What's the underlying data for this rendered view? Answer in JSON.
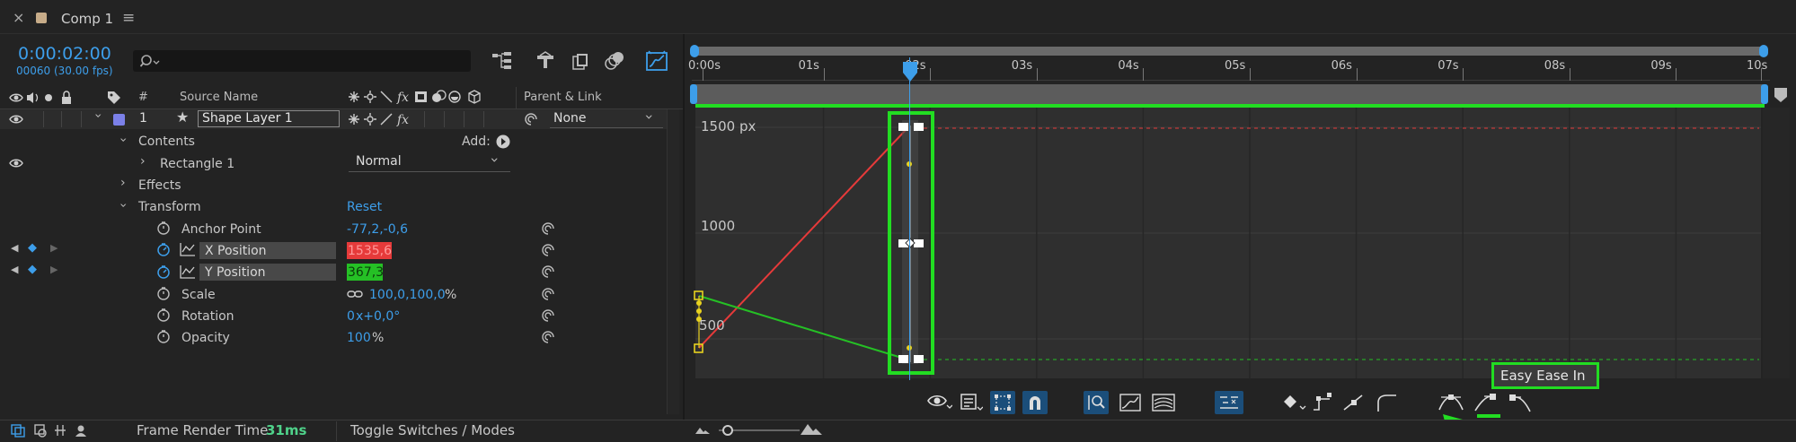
{
  "tab": {
    "close": "×",
    "title": "Comp 1",
    "menu": "≡"
  },
  "time": {
    "timecode": "0:00:02:00",
    "frames": "00060 (30.00 fps)"
  },
  "search": {
    "icon": "search-icon",
    "placeholder": ""
  },
  "columns": {
    "num": "#",
    "source_name": "Source Name",
    "parent_link": "Parent & Link"
  },
  "layer": {
    "index": "1",
    "name": "Shape Layer 1",
    "parent": "None"
  },
  "tree": {
    "contents": "Contents",
    "add_label": "Add:",
    "rectangle": "Rectangle 1",
    "blend_mode": "Normal",
    "effects": "Effects",
    "transform": "Transform",
    "reset": "Reset"
  },
  "properties": [
    {
      "name": "Anchor Point",
      "value": "-77,2,-0,6"
    },
    {
      "name": "X Position",
      "value": "1535,6"
    },
    {
      "name": "Y Position",
      "value": "367,3"
    },
    {
      "name": "Scale",
      "value": "100,0,100,0",
      "suffix": "%"
    },
    {
      "name": "Rotation",
      "value_a": "0",
      "value_b": "x+0,0°"
    },
    {
      "name": "Opacity",
      "value_a": "100",
      "value_b": "%"
    }
  ],
  "ruler": {
    "labels": [
      "0:00s",
      "01s",
      "02s",
      "03s",
      "04s",
      "05s",
      "06s",
      "07s",
      "08s",
      "09s",
      "10s"
    ]
  },
  "graph": {
    "labels": [
      "1500 px",
      "1000",
      "500"
    ]
  },
  "tooltip": {
    "text": "Easy Ease In"
  },
  "status": {
    "frame_render_label": "Frame Render Time",
    "frame_render_value": "31ms",
    "toggle": "Toggle Switches / Modes"
  },
  "colors": {
    "accent_blue": "#3d9eea",
    "highlight_green": "#22dd22",
    "x_position_red": "#e63a3a",
    "y_position_green": "#25c025",
    "keyframe_yellow": "#e8d21f"
  }
}
